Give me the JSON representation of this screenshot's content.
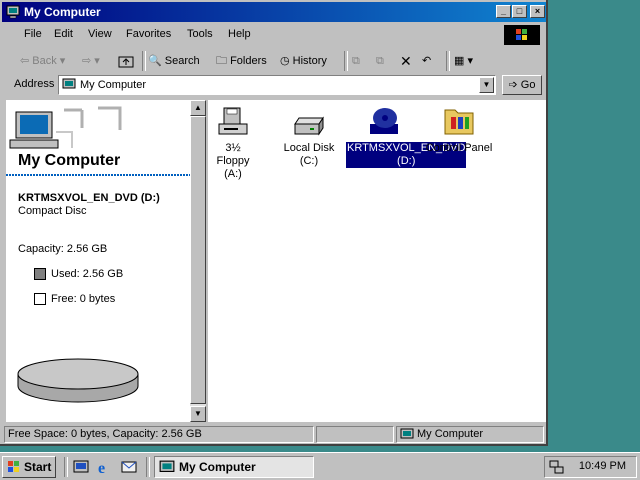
{
  "window": {
    "title": "My Computer"
  },
  "menu": {
    "items": [
      "File",
      "Edit",
      "View",
      "Favorites",
      "Tools",
      "Help"
    ]
  },
  "toolbar": {
    "back": "Back",
    "search": "Search",
    "folders": "Folders",
    "history": "History"
  },
  "address": {
    "label": "Address",
    "value": "My Computer",
    "go": "Go"
  },
  "left_panel": {
    "heading": "My Computer",
    "drive_name": "KRTMSXVOL_EN_DVD (D:)",
    "drive_type": "Compact Disc",
    "capacity": "Capacity: 2.56 GB",
    "used": "Used: 2.56 GB",
    "free": "Free: 0 bytes",
    "used_fraction": 1.0
  },
  "drives": [
    {
      "label": "3½ Floppy (A:)",
      "icon": "floppy-drive-icon",
      "selected": false
    },
    {
      "label": "Local Disk (C:)",
      "icon": "hard-disk-icon",
      "selected": false
    },
    {
      "label": "KRTMSXVOL_EN_DVD (D:)",
      "icon": "dvd-drive-icon",
      "selected": true
    },
    {
      "label": "Control Panel",
      "icon": "control-panel-icon",
      "selected": false
    }
  ],
  "status": {
    "info": "Free Space: 0 bytes, Capacity: 2.56 GB",
    "zone": "My Computer"
  },
  "taskbar": {
    "start": "Start",
    "task": "My Computer",
    "clock": "10:49 PM"
  },
  "colors": {
    "titlebar": "#00007f",
    "desktop": "#3a8a8a",
    "selection": "#00007f"
  }
}
